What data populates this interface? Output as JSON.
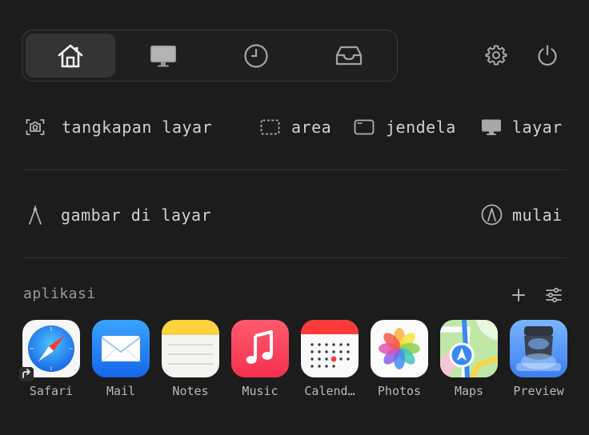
{
  "tabs": [
    {
      "icon": "home-icon",
      "active": true
    },
    {
      "icon": "monitor-icon",
      "active": false
    },
    {
      "icon": "clock-icon",
      "active": false
    },
    {
      "icon": "inbox-tray-icon",
      "active": false
    }
  ],
  "header_icons": [
    "gear-icon",
    "power-icon"
  ],
  "capture": {
    "label": "tangkapan layar",
    "options": [
      {
        "icon": "dashed-area-icon",
        "label": "area"
      },
      {
        "icon": "window-icon",
        "label": "jendela"
      },
      {
        "icon": "display-icon",
        "label": "layar"
      }
    ]
  },
  "draw": {
    "label": "gambar di layar",
    "action_label": "mulai"
  },
  "apps_section": {
    "title": "aplikasi",
    "items": [
      {
        "label": "Safari",
        "icon": "safari-icon"
      },
      {
        "label": "Mail",
        "icon": "mail-icon"
      },
      {
        "label": "Notes",
        "icon": "notes-icon"
      },
      {
        "label": "Music",
        "icon": "music-icon"
      },
      {
        "label": "Calend…",
        "icon": "calendar-icon"
      },
      {
        "label": "Photos",
        "icon": "photos-icon"
      },
      {
        "label": "Maps",
        "icon": "maps-icon"
      },
      {
        "label": "Preview",
        "icon": "preview-icon"
      }
    ]
  },
  "colors": {
    "background": "#1c1c1c",
    "active_tab": "#343434",
    "text": "#d2d2d2"
  }
}
